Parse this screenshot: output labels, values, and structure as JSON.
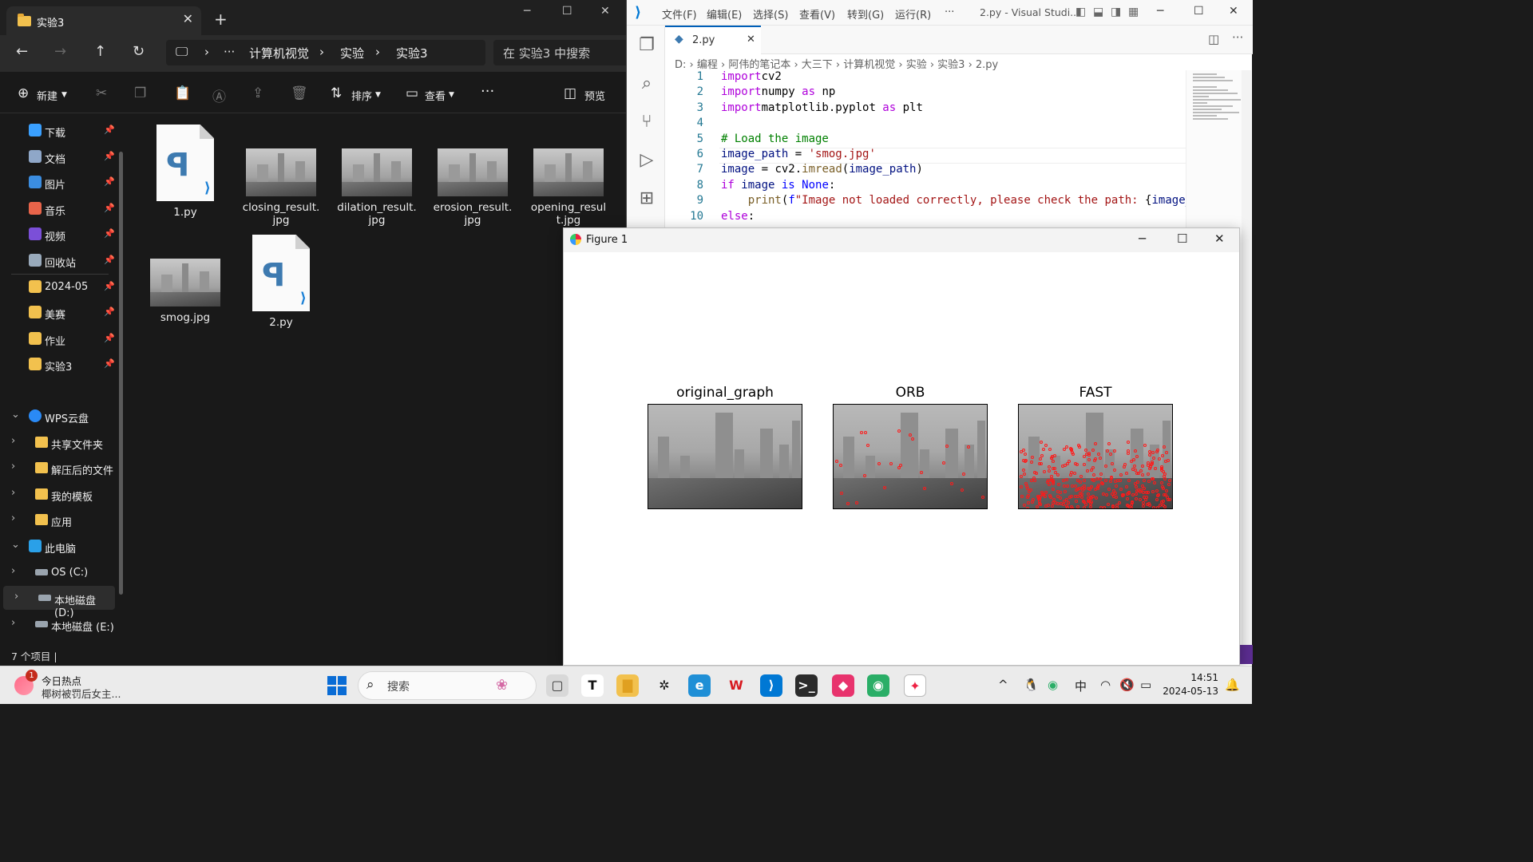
{
  "explorer": {
    "tab_title": "实验3",
    "tab_close": "✕",
    "new_tab": "+",
    "window_controls": {
      "minimize": "─",
      "maximize": "☐",
      "close": "✕"
    },
    "nav": {
      "back": "←",
      "forward": "→",
      "up": "↑",
      "refresh": "↻"
    },
    "address": {
      "more": "···",
      "crumbs": [
        "计算机视觉",
        "实验",
        "实验3"
      ],
      "sep": "›"
    },
    "search_placeholder": "在 实验3 中搜索",
    "toolbar": {
      "new": "新建",
      "sort": "排序",
      "view": "查看",
      "more": "···",
      "preview": "预览"
    },
    "sidebar": {
      "quick": [
        {
          "label": "下载",
          "icon": "download-icon",
          "color": "#3aa0ff"
        },
        {
          "label": "文档",
          "icon": "document-icon",
          "color": "#8fa7c8"
        },
        {
          "label": "图片",
          "icon": "pictures-icon",
          "color": "#3b8de0"
        },
        {
          "label": "音乐",
          "icon": "music-icon",
          "color": "#e8644a"
        },
        {
          "label": "视频",
          "icon": "video-icon",
          "color": "#7b4fd8"
        },
        {
          "label": "回收站",
          "icon": "recycle-bin-icon",
          "color": "#9ab"
        },
        {
          "label": "2024-05",
          "icon": "folder-icon",
          "color": "#f2c14e"
        },
        {
          "label": "美赛",
          "icon": "folder-icon",
          "color": "#f2c14e"
        },
        {
          "label": "作业",
          "icon": "folder-icon",
          "color": "#f2c14e"
        },
        {
          "label": "实验3",
          "icon": "folder-icon",
          "color": "#f2c14e"
        }
      ],
      "wps": "WPS云盘",
      "wps_items": [
        "共享文件夹",
        "解压后的文件",
        "我的模板",
        "应用"
      ],
      "pc": "此电脑",
      "drives": [
        "OS (C:)",
        "本地磁盘 (D:)",
        "本地磁盘 (E:)"
      ]
    },
    "files": [
      {
        "name": "1.py",
        "type": "py"
      },
      {
        "name": "closing_result.jpg",
        "type": "img"
      },
      {
        "name": "dilation_result.jpg",
        "type": "img"
      },
      {
        "name": "erosion_result.jpg",
        "type": "img"
      },
      {
        "name": "opening_result.jpg",
        "type": "img"
      },
      {
        "name": "smog.jpg",
        "type": "img"
      },
      {
        "name": "2.py",
        "type": "py"
      }
    ],
    "status": "7 个项目  |"
  },
  "vscode": {
    "menu": [
      "文件(F)",
      "编辑(E)",
      "选择(S)",
      "查看(V)",
      "转到(G)",
      "运行(R)",
      "···"
    ],
    "title": "2.py - Visual Studi...",
    "tab": "2.py",
    "breadcrumb": "D: › 编程 › 阿伟的笔记本 › 大三下 › 计算机视觉 › 实验 › 实验3 › 2.py",
    "line_numbers": [
      "1",
      "2",
      "3",
      "4",
      "5",
      "6",
      "7",
      "8",
      "9",
      "10"
    ],
    "code": [
      [
        [
          "kw2",
          "import"
        ],
        [
          "",
          "cv2"
        ]
      ],
      [
        [
          "kw2",
          "import"
        ],
        [
          "",
          "numpy "
        ],
        [
          "kw2",
          "as"
        ],
        [
          "",
          " np"
        ]
      ],
      [
        [
          "kw2",
          "import"
        ],
        [
          "",
          "matplotlib.pyplot "
        ],
        [
          "kw2",
          "as"
        ],
        [
          "",
          " plt"
        ]
      ],
      [],
      [
        [
          "cmt",
          "# Load the image"
        ]
      ],
      [
        [
          "var",
          "image_path"
        ],
        [
          "",
          " = "
        ],
        [
          "str",
          "'smog.jpg'"
        ]
      ],
      [
        [
          "var",
          "image"
        ],
        [
          "",
          " = cv2."
        ],
        [
          "fn",
          "imread"
        ],
        [
          "",
          "("
        ],
        [
          "var",
          "image_path"
        ],
        [
          "",
          ")"
        ]
      ],
      [
        [
          "kw2",
          "if"
        ],
        [
          "var",
          " image"
        ],
        [
          "",
          " "
        ],
        [
          "kw",
          "is"
        ],
        [
          "",
          " "
        ],
        [
          "kw",
          "None"
        ],
        [
          "",
          ":"
        ]
      ],
      [
        [
          "",
          "    "
        ],
        [
          "fn",
          "print"
        ],
        [
          "",
          "("
        ],
        [
          "kw",
          "f"
        ],
        [
          "str",
          "\"Image not loaded correctly, please check the path: "
        ],
        [
          "",
          "{"
        ],
        [
          "var",
          "image_path"
        ]
      ],
      [
        [
          "kw2",
          "else"
        ],
        [
          "",
          ":"
        ]
      ]
    ]
  },
  "figure": {
    "title": "Figure 1",
    "subplots": [
      {
        "title": "original_graph",
        "keypoints": "none"
      },
      {
        "title": "ORB",
        "keypoints": "sparse"
      },
      {
        "title": "FAST",
        "keypoints": "dense"
      }
    ]
  },
  "taskbar": {
    "news_title": "今日热点",
    "news_sub": "椰树被罚后女主...",
    "news_badge": "1",
    "search": "搜索",
    "apps": [
      {
        "name": "task-view",
        "glyph": "▢",
        "bg": "#d8d8d8",
        "fg": "#333"
      },
      {
        "name": "typora",
        "glyph": "T",
        "bg": "#ffffff",
        "fg": "#111"
      },
      {
        "name": "file-explorer",
        "glyph": "▇",
        "bg": "#f2c14e",
        "fg": "#e0a020"
      },
      {
        "name": "chatgpt",
        "glyph": "✲",
        "bg": "#ebebeb",
        "fg": "#111"
      },
      {
        "name": "edge",
        "glyph": "e",
        "bg": "#1f8fd6",
        "fg": "#fff"
      },
      {
        "name": "wps",
        "glyph": "W",
        "bg": "#ebebeb",
        "fg": "#d7191f"
      },
      {
        "name": "vscode",
        "glyph": "⟩",
        "bg": "#0078d4",
        "fg": "#fff"
      },
      {
        "name": "terminal",
        "glyph": ">_",
        "bg": "#2b2b2b",
        "fg": "#fff"
      },
      {
        "name": "pycharm-ish",
        "glyph": "◆",
        "bg": "#e8336d",
        "fg": "#fff"
      },
      {
        "name": "wechat",
        "glyph": "◉",
        "bg": "#2aae67",
        "fg": "#fff"
      },
      {
        "name": "matplotlib",
        "glyph": "✦",
        "bg": "#ffffff",
        "fg": "#e24"
      }
    ],
    "tray": {
      "chevron": "^",
      "ime": "中",
      "time": "14:51",
      "date": "2024-05-13"
    }
  }
}
